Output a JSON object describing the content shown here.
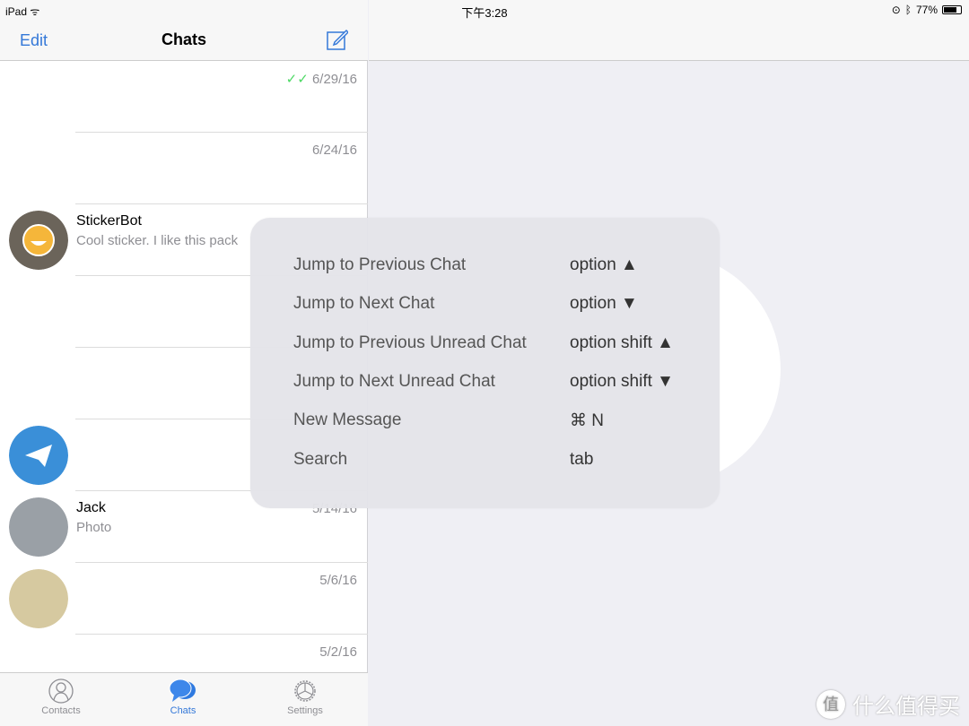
{
  "status": {
    "device": "iPad",
    "time": "下午3:28",
    "battery": "77%"
  },
  "nav": {
    "edit": "Edit",
    "title": "Chats"
  },
  "chats": [
    {
      "name": "",
      "message": "",
      "date": "6/29/16",
      "read": true
    },
    {
      "name": "",
      "message": "",
      "date": "6/24/16"
    },
    {
      "name": "StickerBot",
      "message": "Cool sticker. I like this pack",
      "date": ""
    },
    {
      "name": "",
      "message": "",
      "date": ""
    },
    {
      "name": "",
      "message": "",
      "date": ""
    },
    {
      "name": "",
      "message": "",
      "date": ""
    },
    {
      "name": "Jack",
      "message": "Photo",
      "date": "5/14/16"
    },
    {
      "name": "",
      "message": "",
      "date": "5/6/16"
    },
    {
      "name": "",
      "message": "",
      "date": "5/2/16"
    }
  ],
  "tabs": [
    {
      "label": "Contacts"
    },
    {
      "label": "Chats",
      "active": true
    },
    {
      "label": "Settings"
    }
  ],
  "shortcuts": [
    {
      "label": "Jump to Previous Chat",
      "key": "option ▲"
    },
    {
      "label": "Jump to Next Chat",
      "key": "option ▼"
    },
    {
      "label": "Jump to Previous Unread Chat",
      "key": "option shift ▲"
    },
    {
      "label": "Jump to Next Unread Chat",
      "key": "option shift ▼"
    },
    {
      "label": "New Message",
      "key": "⌘ N"
    },
    {
      "label": "Search",
      "key": "tab"
    }
  ],
  "watermark": {
    "badge": "值",
    "text": "什么值得买"
  },
  "colors": {
    "accent": "#3478d8",
    "check": "#4cd964"
  }
}
